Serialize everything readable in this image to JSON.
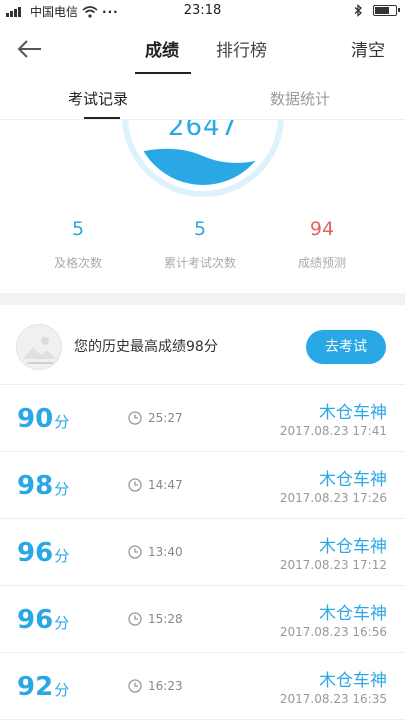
{
  "status_bar": {
    "carrier": "中国电信",
    "dots": "···",
    "time": "23:18"
  },
  "nav": {
    "tabs": [
      "成绩",
      "排行榜"
    ],
    "clear_label": "清空"
  },
  "subtabs": [
    "考试记录",
    "数据统计"
  ],
  "gauge": {
    "value": "2647",
    "fill_fraction": 0.4,
    "color": "#2aa8e6"
  },
  "stats": [
    {
      "value": "5",
      "label": "及格次数"
    },
    {
      "value": "5",
      "label": "累计考试次数"
    },
    {
      "value": "94",
      "label": "成绩预测"
    }
  ],
  "best": {
    "text": "您的历史最高成绩98分",
    "button_label": "去考试"
  },
  "records": [
    {
      "score": "90",
      "unit": "分",
      "duration": "25:27",
      "user": "木仓车神",
      "datetime": "2017.08.23  17:41"
    },
    {
      "score": "98",
      "unit": "分",
      "duration": "14:47",
      "user": "木仓车神",
      "datetime": "2017.08.23  17:26"
    },
    {
      "score": "96",
      "unit": "分",
      "duration": "13:40",
      "user": "木仓车神",
      "datetime": "2017.08.23  17:12"
    },
    {
      "score": "96",
      "unit": "分",
      "duration": "15:28",
      "user": "木仓车神",
      "datetime": "2017.08.23  16:56"
    },
    {
      "score": "92",
      "unit": "分",
      "duration": "16:23",
      "user": "木仓车神",
      "datetime": "2017.08.23  16:35"
    }
  ],
  "icons": {
    "back": "back-arrow-icon",
    "clock": "clock-icon",
    "bluetooth": "bluetooth-icon",
    "wifi": "wifi-icon",
    "battery": "battery-icon"
  },
  "colors": {
    "accent": "#2aa8e6",
    "prediction": "#e66161"
  }
}
